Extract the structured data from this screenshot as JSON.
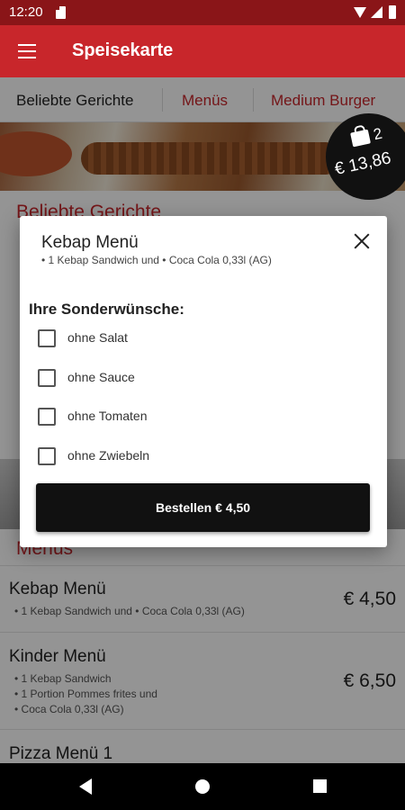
{
  "status_bar": {
    "time": "12:20"
  },
  "app_bar": {
    "title": "Speisekarte"
  },
  "tabs": [
    {
      "label": "Beliebte Gerichte",
      "active": true
    },
    {
      "label": "Menüs",
      "active": false
    },
    {
      "label": "Medium Burger",
      "active": false
    }
  ],
  "cart": {
    "count": "2",
    "total": "€ 13,86"
  },
  "background_list": {
    "section1_title": "Beliebte Gerichte",
    "section2_title": "Menüs",
    "items": [
      {
        "name": "Kebap Menü",
        "desc": [
          "• 1 Kebap Sandwich und    • Coca Cola 0,33l  (AG)"
        ],
        "price": "€ 4,50"
      },
      {
        "name": "Kinder Menü",
        "desc": [
          "• 1 Kebap Sandwich",
          "• 1 Portion Pommes frites und",
          "• Coca Cola 0,33l  (AG)"
        ],
        "price": "€ 6,50"
      },
      {
        "name": "Pizza Menü 1",
        "desc": [],
        "price": ""
      }
    ]
  },
  "dialog": {
    "title": "Kebap Menü",
    "description": "• 1 Kebap Sandwich und    • Coca Cola 0,33l  (AG)",
    "section_title": "Ihre Sonderwünsche:",
    "options": [
      {
        "label": "ohne Salat",
        "checked": false
      },
      {
        "label": "ohne Sauce",
        "checked": false
      },
      {
        "label": "ohne Tomaten",
        "checked": false
      },
      {
        "label": "ohne Zwiebeln",
        "checked": false
      }
    ],
    "order_button": "Bestellen € 4,50"
  },
  "icons": {
    "menu": "hamburger-menu-icon",
    "close": "close-icon",
    "cart": "shopping-bag-icon",
    "nav_back": "back-triangle-icon",
    "nav_home": "home-circle-icon",
    "nav_recent": "recent-apps-square-icon"
  },
  "colors": {
    "brand": "#c8262b",
    "status_bar": "#8a1518",
    "button": "#111111"
  }
}
